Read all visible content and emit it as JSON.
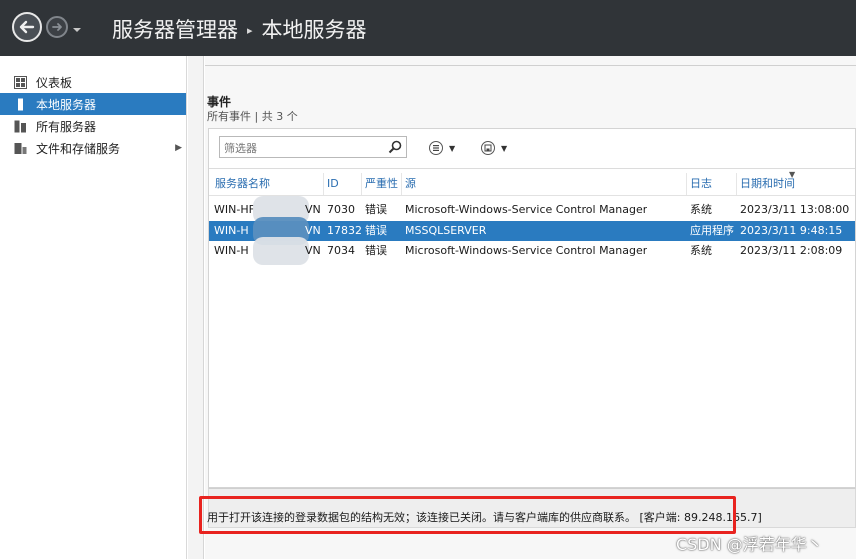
{
  "titlebar": {
    "app_title": "服务器管理器",
    "page_title": "本地服务器",
    "separator": "▸"
  },
  "sidebar": {
    "items": [
      {
        "label": "仪表板",
        "icon": "dashboard-icon"
      },
      {
        "label": "本地服务器",
        "icon": "server-icon",
        "active": true
      },
      {
        "label": "所有服务器",
        "icon": "servers-icon"
      },
      {
        "label": "文件和存储服务",
        "icon": "storage-icon",
        "has_submenu": true
      }
    ]
  },
  "events": {
    "title": "事件",
    "subtitle": "所有事件 | 共 3 个",
    "filter": {
      "placeholder": "筛选器"
    },
    "columns": [
      "服务器名称",
      "ID",
      "严重性",
      "源",
      "日志",
      "日期和时间"
    ],
    "rows": [
      {
        "server_prefix": "WIN-HF",
        "server_suffix": "VN",
        "id": "7030",
        "severity": "错误",
        "source": "Microsoft-Windows-Service Control Manager",
        "log": "系统",
        "datetime": "2023/3/11 13:08:00",
        "selected": false
      },
      {
        "server_prefix": "WIN-H",
        "server_suffix": "VN",
        "id": "17832",
        "severity": "错误",
        "source": "MSSQLSERVER",
        "log": "应用程序",
        "datetime": "2023/3/11 9:48:15",
        "selected": true
      },
      {
        "server_prefix": "WIN-H",
        "server_suffix": "VN",
        "id": "7034",
        "severity": "错误",
        "source": "Microsoft-Windows-Service Control Manager",
        "log": "系统",
        "datetime": "2023/3/11 2:08:09",
        "selected": false
      }
    ]
  },
  "status": {
    "message": "用于打开该连接的登录数据包的结构无效；该连接已关闭。请与客户端库的供应商联系。 [客户端: 89.248.165.7]"
  },
  "watermark": "CSDN @浮若年华丶",
  "colors": {
    "accent": "#2a7bc0",
    "titlebar": "#303438",
    "highlight": "#e8231f",
    "header_text": "#2a6db0"
  }
}
